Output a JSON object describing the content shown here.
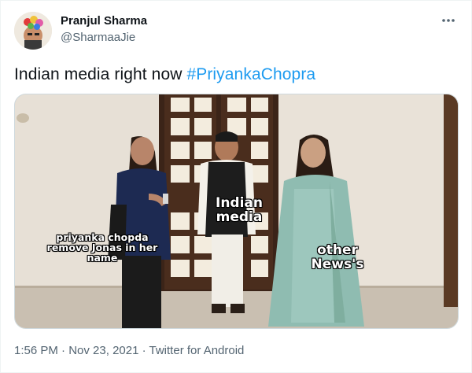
{
  "author": {
    "name": "Pranjul Sharma",
    "handle": "@SharmaaJie"
  },
  "tweet": {
    "text": "Indian media right now ",
    "hashtag": "#PriyankaChopra"
  },
  "meme": {
    "left_caption": "priyanka chopda remove Jonas in her name",
    "middle_caption": "Indian media",
    "right_caption": "other News's"
  },
  "meta": {
    "time": "1:56 PM",
    "sep1": " · ",
    "date": "Nov 23, 2021",
    "sep2": " · ",
    "source": "Twitter for Android"
  },
  "colors": {
    "link": "#1d9bf0",
    "secondary_text": "#536471",
    "primary_text": "#0f1419"
  }
}
